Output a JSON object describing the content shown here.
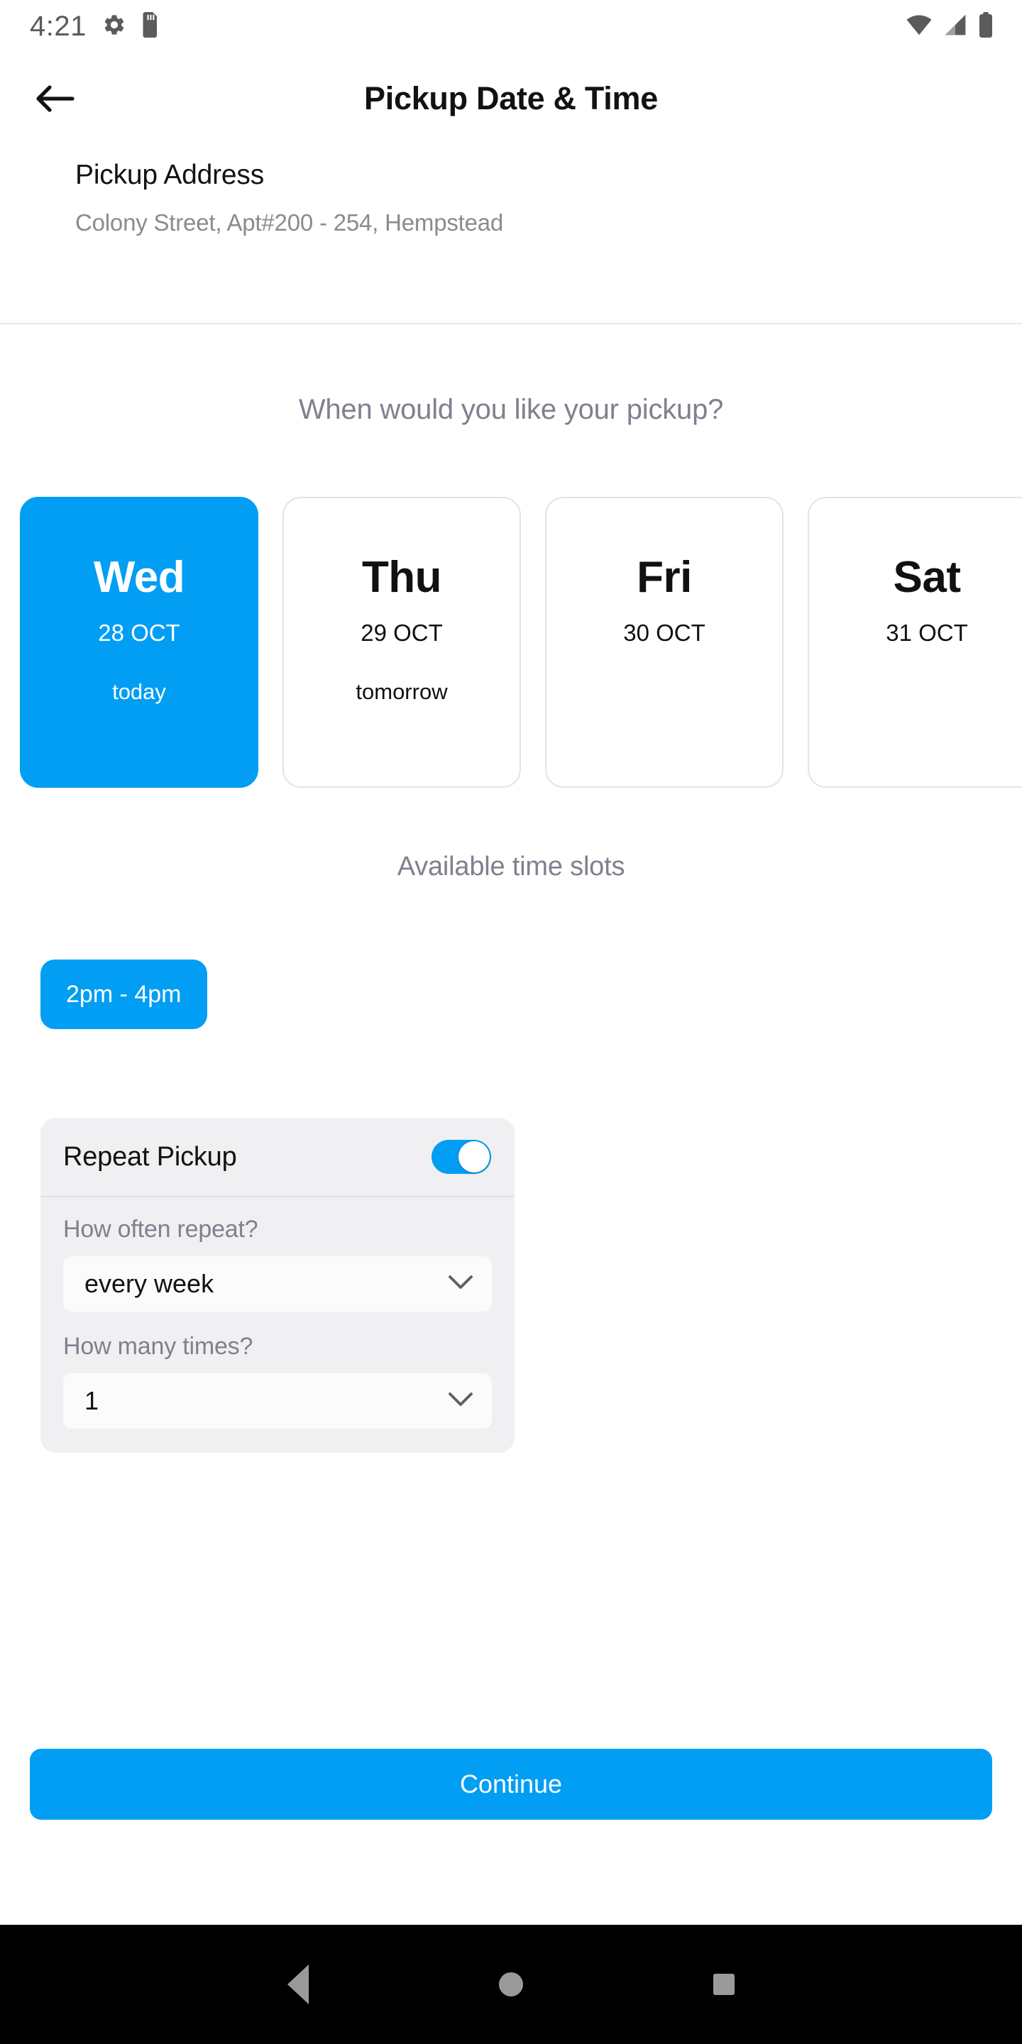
{
  "statusbar": {
    "time": "4:21",
    "icons": [
      "gear-icon",
      "sd-card-icon",
      "wifi-icon",
      "cellular-signal-icon",
      "battery-icon"
    ]
  },
  "appbar": {
    "title": "Pickup Date & Time",
    "back_icon": "arrow-left-icon"
  },
  "address": {
    "title": "Pickup Address",
    "value": "Colony Street, Apt#200 - 254, Hempstead"
  },
  "date_section": {
    "question": "When would you like your pickup?",
    "cards": [
      {
        "day": "Wed",
        "date": "28 OCT",
        "relative": "today",
        "selected": true
      },
      {
        "day": "Thu",
        "date": "29 OCT",
        "relative": "tomorrow",
        "selected": false
      },
      {
        "day": "Fri",
        "date": "30 OCT",
        "relative": "",
        "selected": false
      },
      {
        "day": "Sat",
        "date": "31 OCT",
        "relative": "",
        "selected": false
      }
    ]
  },
  "time_section": {
    "title": "Available time slots",
    "slots": [
      {
        "label": "2pm - 4pm",
        "selected": true
      }
    ]
  },
  "repeat": {
    "label": "Repeat Pickup",
    "toggle_on": true,
    "frequency": {
      "label": "How often repeat?",
      "value": "every week",
      "chevron": "chevron-down-icon"
    },
    "count": {
      "label": "How many times?",
      "value": "1",
      "chevron": "chevron-down-icon"
    }
  },
  "footer": {
    "continue_label": "Continue"
  },
  "navbar": {
    "back": "triangle-back-icon",
    "home": "circle-home-icon",
    "recents": "square-recents-icon"
  },
  "colors": {
    "accent": "#029ef4",
    "muted_text": "#80808e",
    "card_bg": "#f0f0f2"
  }
}
